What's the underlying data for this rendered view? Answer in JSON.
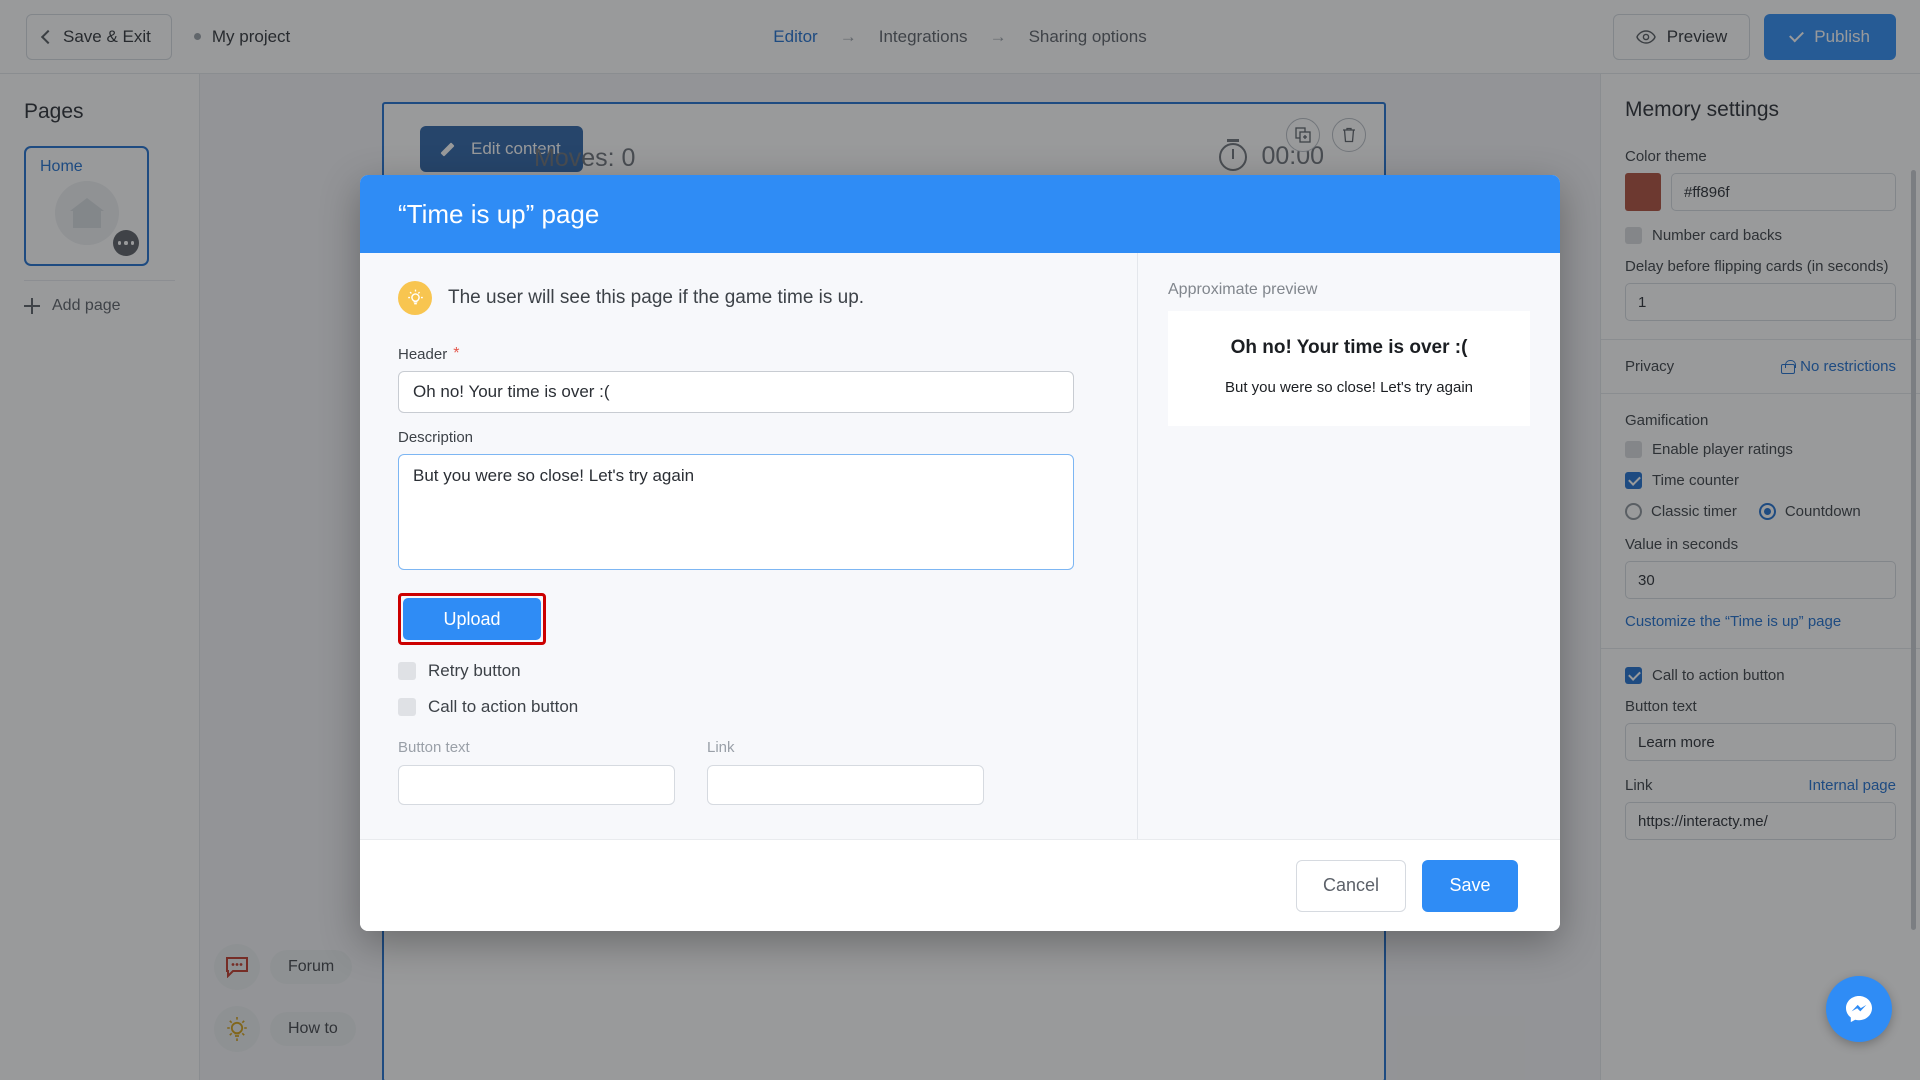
{
  "topbar": {
    "save_exit_label": "Save & Exit",
    "project_name": "My project",
    "steps": [
      {
        "label": "Editor",
        "active": true
      },
      {
        "label": "Integrations",
        "active": false
      },
      {
        "label": "Sharing options",
        "active": false
      }
    ],
    "arrow": "→",
    "preview_label": "Preview",
    "publish_label": "Publish"
  },
  "pages_panel": {
    "title": "Pages",
    "page_card_label": "Home",
    "add_page_label": "Add page"
  },
  "canvas": {
    "edit_content_label": "Edit content",
    "moves_label": "Moves: 0",
    "timer_value": "00:00"
  },
  "helpers": [
    {
      "label": "Forum",
      "icon": "chat-icon"
    },
    {
      "label": "How to",
      "icon": "lightbulb-icon"
    }
  ],
  "settings": {
    "title": "Memory settings",
    "color_theme_label": "Color theme",
    "color_theme_value": "#ff896f",
    "color_theme_swatch": "#b04f3c",
    "number_card_backs_label": "Number card backs",
    "number_card_backs_checked": false,
    "delay_label": "Delay before flipping cards (in seconds)",
    "delay_value": "1",
    "privacy_label": "Privacy",
    "privacy_value": "No restrictions",
    "gamification_label": "Gamification",
    "enable_ratings_label": "Enable player ratings",
    "enable_ratings_checked": false,
    "time_counter_label": "Time counter",
    "time_counter_checked": true,
    "timer_mode_classic": "Classic timer",
    "timer_mode_countdown": "Countdown",
    "timer_mode_selected": "Countdown",
    "value_seconds_label": "Value in seconds",
    "value_seconds": "30",
    "customize_link": "Customize the “Time is up” page",
    "cta_label": "Call to action button",
    "cta_checked": true,
    "button_text_label": "Button text",
    "button_text_value": "Learn more",
    "link_label": "Link",
    "link_mode": "Internal page",
    "link_value": "https://interacty.me/"
  },
  "modal": {
    "title": "“Time is up” page",
    "hint": "The user will see this page if the game time is up.",
    "header_label": "Header",
    "header_required_mark": "*",
    "header_value": "Oh no! Your time is over :(",
    "description_label": "Description",
    "description_value": "But you were so close! Let's try again",
    "upload_label": "Upload",
    "retry_button_label": "Retry button",
    "retry_button_checked": false,
    "cta_button_label": "Call to action button",
    "cta_button_checked": false,
    "button_text_label": "Button text",
    "button_text_value": "",
    "link_label": "Link",
    "link_value": "",
    "preview_caption": "Approximate preview",
    "preview_header": "Oh no! Your time is over :(",
    "preview_description": "But you were so close! Let's try again",
    "cancel_label": "Cancel",
    "save_label": "Save"
  },
  "colors": {
    "accent_blue": "#2f8cf5",
    "link_blue": "#1f6fd0",
    "highlight_red": "#cc0000",
    "bulb_yellow": "#f8c550"
  }
}
